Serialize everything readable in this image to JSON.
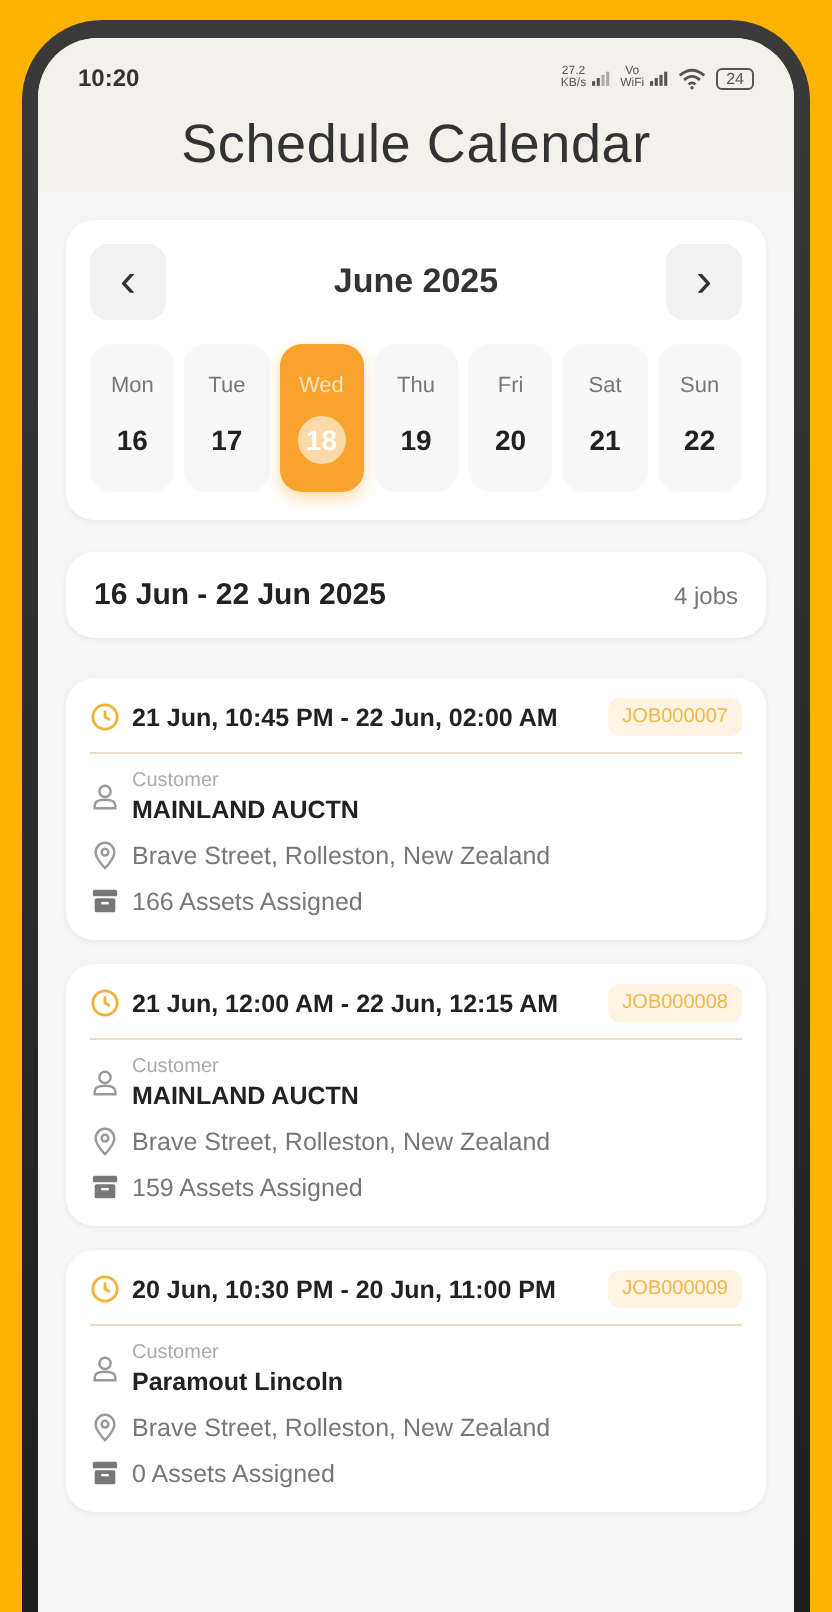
{
  "status_bar": {
    "time": "10:20",
    "speed": "27.2",
    "speed_unit": "KB/s",
    "volte": "Vo",
    "volte_sub": "WiFi",
    "battery": "24"
  },
  "title": "Schedule Calendar",
  "calendar": {
    "month": "June 2025",
    "prev": "‹",
    "next": "›",
    "days": [
      {
        "weekday": "Mon",
        "date": "16",
        "selected": false
      },
      {
        "weekday": "Tue",
        "date": "17",
        "selected": false
      },
      {
        "weekday": "Wed",
        "date": "18",
        "selected": true
      },
      {
        "weekday": "Thu",
        "date": "19",
        "selected": false
      },
      {
        "weekday": "Fri",
        "date": "20",
        "selected": false
      },
      {
        "weekday": "Sat",
        "date": "21",
        "selected": false
      },
      {
        "weekday": "Sun",
        "date": "22",
        "selected": false
      }
    ]
  },
  "range": {
    "label": "16 Jun - 22 Jun 2025",
    "count": "4 jobs"
  },
  "jobs": [
    {
      "time": "21 Jun, 10:45 PM - 22 Jun, 02:00 AM",
      "job_id": "JOB000007",
      "customer_label": "Customer",
      "customer": "MAINLAND AUCTN",
      "address": "Brave Street, Rolleston, New Zealand",
      "assets": "166 Assets Assigned"
    },
    {
      "time": "21 Jun, 12:00 AM - 22 Jun, 12:15 AM",
      "job_id": "JOB000008",
      "customer_label": "Customer",
      "customer": "MAINLAND AUCTN",
      "address": "Brave Street, Rolleston, New Zealand",
      "assets": "159 Assets Assigned"
    },
    {
      "time": "20 Jun, 10:30 PM - 20 Jun, 11:00 PM",
      "job_id": "JOB000009",
      "customer_label": "Customer",
      "customer": "Paramout Lincoln",
      "address": "Brave Street, Rolleston, New Zealand",
      "assets": "0 Assets Assigned"
    }
  ]
}
